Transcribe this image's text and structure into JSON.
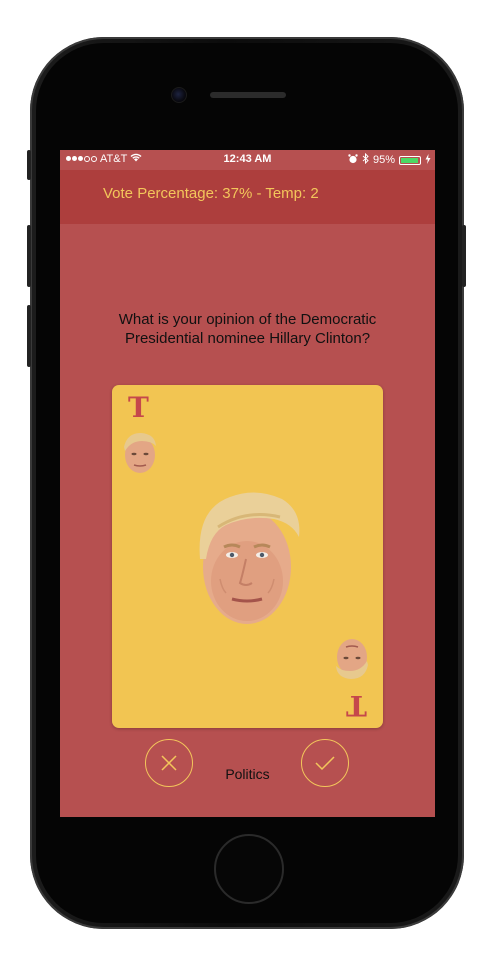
{
  "status_bar": {
    "carrier": "AT&T",
    "time": "12:43 AM",
    "battery_percent": "95%",
    "battery_level": 0.95,
    "signal_bars_filled": 3,
    "signal_bars_total": 5
  },
  "header": {
    "title": "Vote Percentage: 37% - Temp: 2"
  },
  "question": {
    "text": "What is your opinion of the Democratic Presidential nominee Hillary Clinton?"
  },
  "card": {
    "corner_letter": "T",
    "image": "trump-face"
  },
  "actions": {
    "reject_icon": "x-icon",
    "accept_icon": "check-icon",
    "category": "Politics"
  },
  "colors": {
    "screen_bg": "#b65050",
    "navbar_bg": "#ad3e3d",
    "accent": "#f3c65b",
    "card_bg": "#f2c552",
    "card_letter": "#c5484b"
  }
}
